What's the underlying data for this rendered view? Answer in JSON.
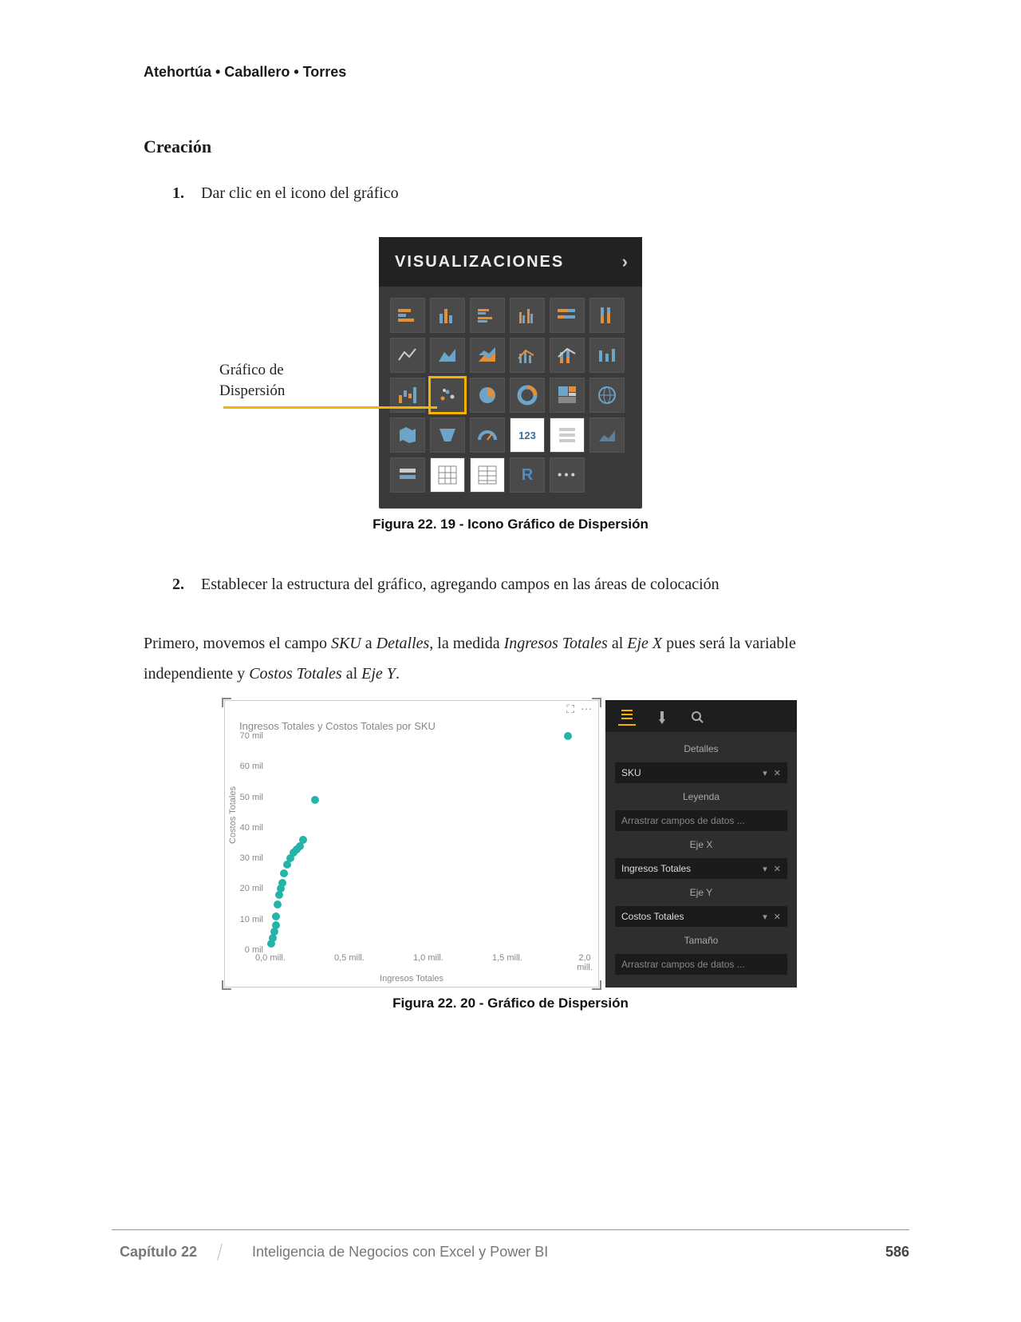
{
  "authors": "Atehortúa • Caballero • Torres",
  "section_heading": "Creación",
  "steps": [
    {
      "num": "1.",
      "text": "Dar clic en el icono del gráfico"
    },
    {
      "num": "2.",
      "text": "Establecer la estructura del gráfico, agregando campos en las áreas de colocación"
    }
  ],
  "callout": {
    "line1": "Gráfico de",
    "line2": "Dispersión"
  },
  "viz_panel": {
    "title": "VISUALIZACIONES"
  },
  "caption19": "Figura 22. 19 - Icono Gráfico de Dispersión",
  "paragraph": {
    "p1": "Primero, movemos el campo ",
    "sku": "SKU",
    "p2": " a ",
    "det": "Detalles",
    "p3": ", la medida ",
    "ing": "Ingresos Totales",
    "p4": " al ",
    "ejex": "Eje X",
    "p5": " pues será la variable independiente y ",
    "ct": "Costos Totales",
    "p6": " al ",
    "ejey": "Eje Y",
    "p7": "."
  },
  "scatter": {
    "title": "Ingresos Totales y Costos Totales por SKU",
    "xlabel": "Ingresos Totales",
    "ylabel": "Costos Totales",
    "y_ticks": [
      "0 mil",
      "10 mil",
      "20 mil",
      "30 mil",
      "40 mil",
      "50 mil",
      "60 mil",
      "70 mil"
    ],
    "x_ticks": [
      "0,0 mill.",
      "0,5 mill.",
      "1,0 mill.",
      "1,5 mill.",
      "2,0 mill."
    ]
  },
  "chart_data": {
    "type": "scatter",
    "title": "Ingresos Totales y Costos Totales por SKU",
    "xlabel": "Ingresos Totales",
    "ylabel": "Costos Totales",
    "xlim": [
      0.0,
      2.0
    ],
    "ylim": [
      0,
      70
    ],
    "x_unit": "millones",
    "y_unit": "miles",
    "series": [
      {
        "name": "SKU",
        "points": [
          {
            "x": 0.02,
            "y": 2
          },
          {
            "x": 0.03,
            "y": 4
          },
          {
            "x": 0.04,
            "y": 6
          },
          {
            "x": 0.05,
            "y": 8
          },
          {
            "x": 0.05,
            "y": 11
          },
          {
            "x": 0.06,
            "y": 15
          },
          {
            "x": 0.07,
            "y": 18
          },
          {
            "x": 0.08,
            "y": 20
          },
          {
            "x": 0.09,
            "y": 22
          },
          {
            "x": 0.1,
            "y": 25
          },
          {
            "x": 0.12,
            "y": 28
          },
          {
            "x": 0.14,
            "y": 30
          },
          {
            "x": 0.16,
            "y": 32
          },
          {
            "x": 0.18,
            "y": 33
          },
          {
            "x": 0.2,
            "y": 34
          },
          {
            "x": 0.22,
            "y": 36
          },
          {
            "x": 0.3,
            "y": 49
          },
          {
            "x": 1.9,
            "y": 70
          }
        ]
      }
    ]
  },
  "fields": {
    "detalles": "Detalles",
    "sku": "SKU",
    "leyenda": "Leyenda",
    "drag": "Arrastrar campos de datos ...",
    "ejex": "Eje X",
    "ingresos": "Ingresos Totales",
    "ejey": "Eje Y",
    "costos": "Costos Totales",
    "tamano": "Tamaño"
  },
  "caption20": "Figura 22. 20 - Gráfico de Dispersión",
  "footer": {
    "chapter": "Capítulo 22",
    "title": "Inteligencia de Negocios con Excel y Power BI",
    "page": "586"
  }
}
